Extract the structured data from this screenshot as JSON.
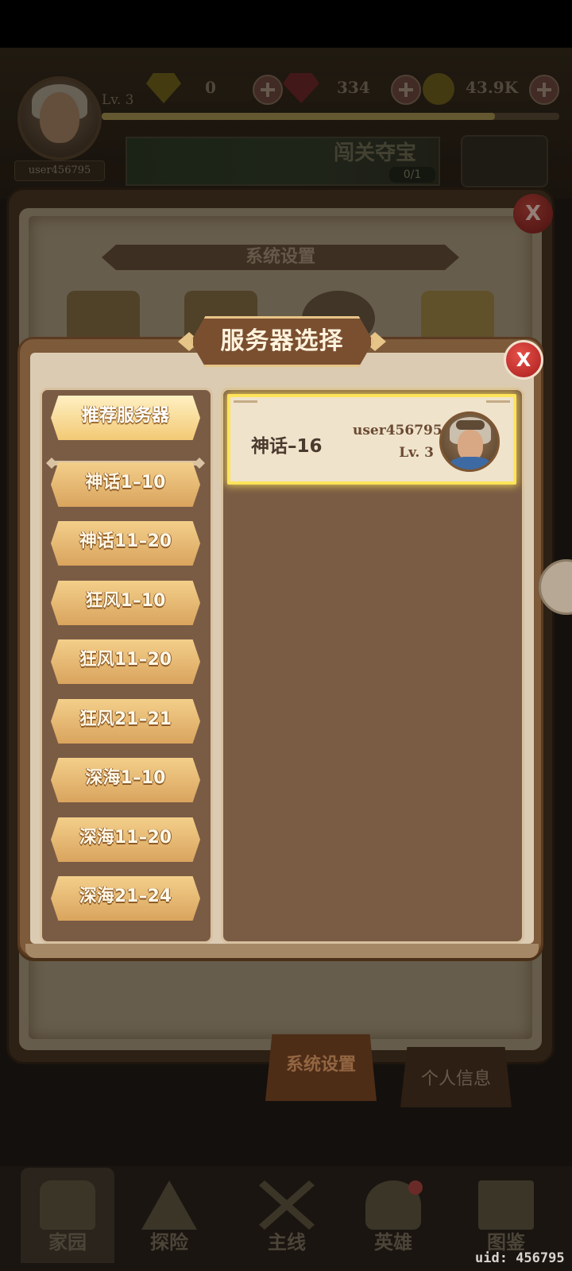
{
  "hud": {
    "level": "Lv. 3",
    "username": "user456795",
    "resources": {
      "gems_yellow": "0",
      "gems_red": "334",
      "gold": "43.9K"
    },
    "xp_fraction": 0.86
  },
  "banner": {
    "title": "闯关夺宝",
    "count": "0/1"
  },
  "settings": {
    "title": "系统设置",
    "tabs": {
      "system": "系统设置",
      "personal": "个人信息"
    },
    "close_label": "X"
  },
  "dialog": {
    "title": "服务器选择",
    "close_label": "X",
    "recommended_label": "推荐服务器",
    "groups": [
      "神话1–10",
      "神话11–20",
      "狂风1–10",
      "狂风11–20",
      "狂风21–21",
      "深海1–10",
      "深海11–20",
      "深海21–24"
    ],
    "servers": [
      {
        "name": "神话–16",
        "user": "user456795",
        "level": "Lv. 3"
      }
    ]
  },
  "bottom_nav": {
    "items": [
      "家园",
      "探险",
      "主线",
      "英雄",
      "图鉴"
    ]
  },
  "footer": {
    "uid": "uid: 456795"
  },
  "colors": {
    "dialog_board": "#dbcbb2",
    "panel_brown": "#7a5c45",
    "button_gold": "#f3cf8a",
    "highlight": "#ffe45a",
    "close_red": "#e7504a"
  }
}
